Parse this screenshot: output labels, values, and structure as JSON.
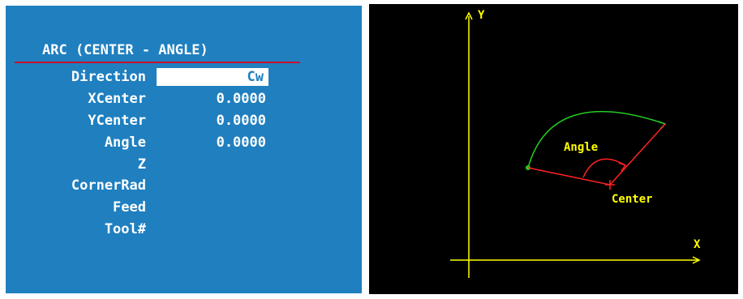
{
  "form": {
    "title": "ARC (CENTER - ANGLE)",
    "fields": [
      {
        "label": "Direction",
        "value": "Cw"
      },
      {
        "label": "XCenter",
        "value": "0.0000"
      },
      {
        "label": "YCenter",
        "value": "0.0000"
      },
      {
        "label": "Angle",
        "value": "0.0000"
      },
      {
        "label": "Z",
        "value": ""
      },
      {
        "label": "CornerRad",
        "value": ""
      },
      {
        "label": "Feed",
        "value": ""
      },
      {
        "label": "Tool#",
        "value": ""
      }
    ]
  },
  "diagram": {
    "y_axis_label": "Y",
    "x_axis_label": "X",
    "angle_label": "Angle",
    "center_label": "Center"
  },
  "colors": {
    "panel_bg": "#1f7fbf",
    "diagram_bg": "#000000",
    "axis": "#ffff00",
    "arc": "#22cc22",
    "radius_lines": "#ff2222"
  }
}
